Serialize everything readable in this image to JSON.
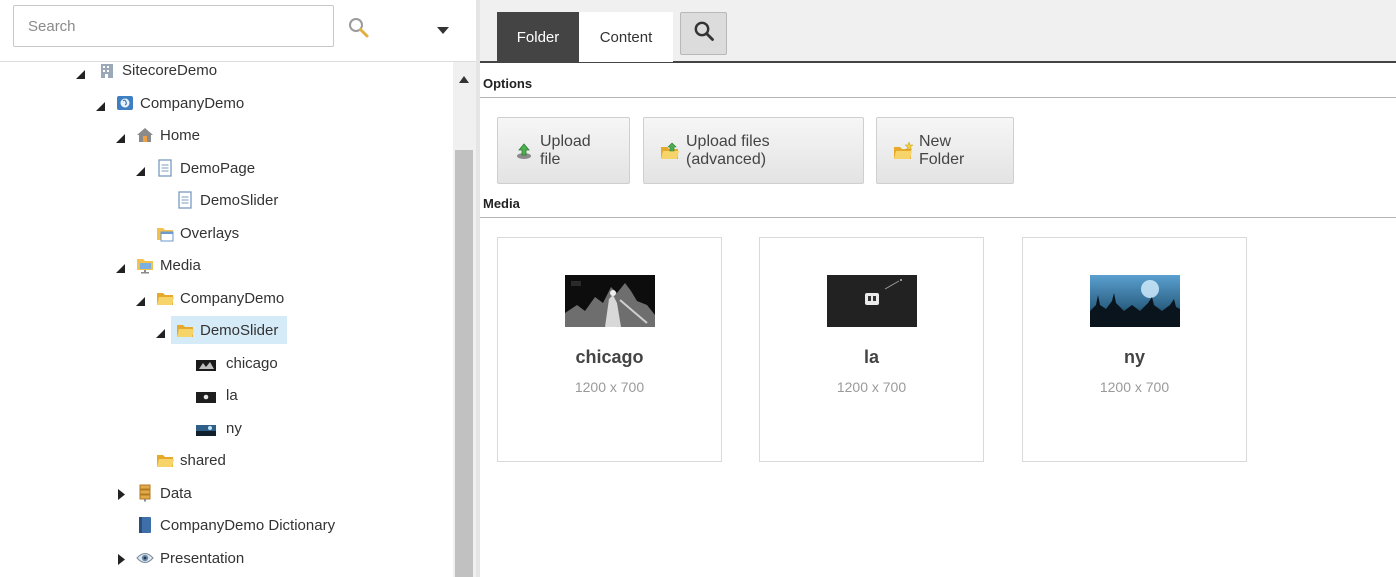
{
  "search": {
    "placeholder": "Search"
  },
  "tree": {
    "sitecore_demo": "SitecoreDemo",
    "company_demo": "CompanyDemo",
    "home": "Home",
    "demo_page": "DemoPage",
    "demo_slider_item": "DemoSlider",
    "overlays": "Overlays",
    "media": "Media",
    "media_company_demo": "CompanyDemo",
    "media_demo_slider": "DemoSlider",
    "chicago": "chicago",
    "la": "la",
    "ny": "ny",
    "shared": "shared",
    "data": "Data",
    "dictionary": "CompanyDemo Dictionary",
    "presentation": "Presentation"
  },
  "tabs": {
    "folder": "Folder",
    "content": "Content"
  },
  "sections": {
    "options": "Options",
    "media": "Media"
  },
  "buttons": {
    "upload_file": "Upload file",
    "upload_files_advanced": "Upload files (advanced)",
    "new_folder": "New Folder"
  },
  "media_items": [
    {
      "name": "chicago",
      "dims": "1200 x 700"
    },
    {
      "name": "la",
      "dims": "1200 x 700"
    },
    {
      "name": "ny",
      "dims": "1200 x 700"
    }
  ],
  "colors": {
    "selected_bg": "#d6ebf8",
    "active_tab": "#444444",
    "accent": "#4a90c8"
  }
}
